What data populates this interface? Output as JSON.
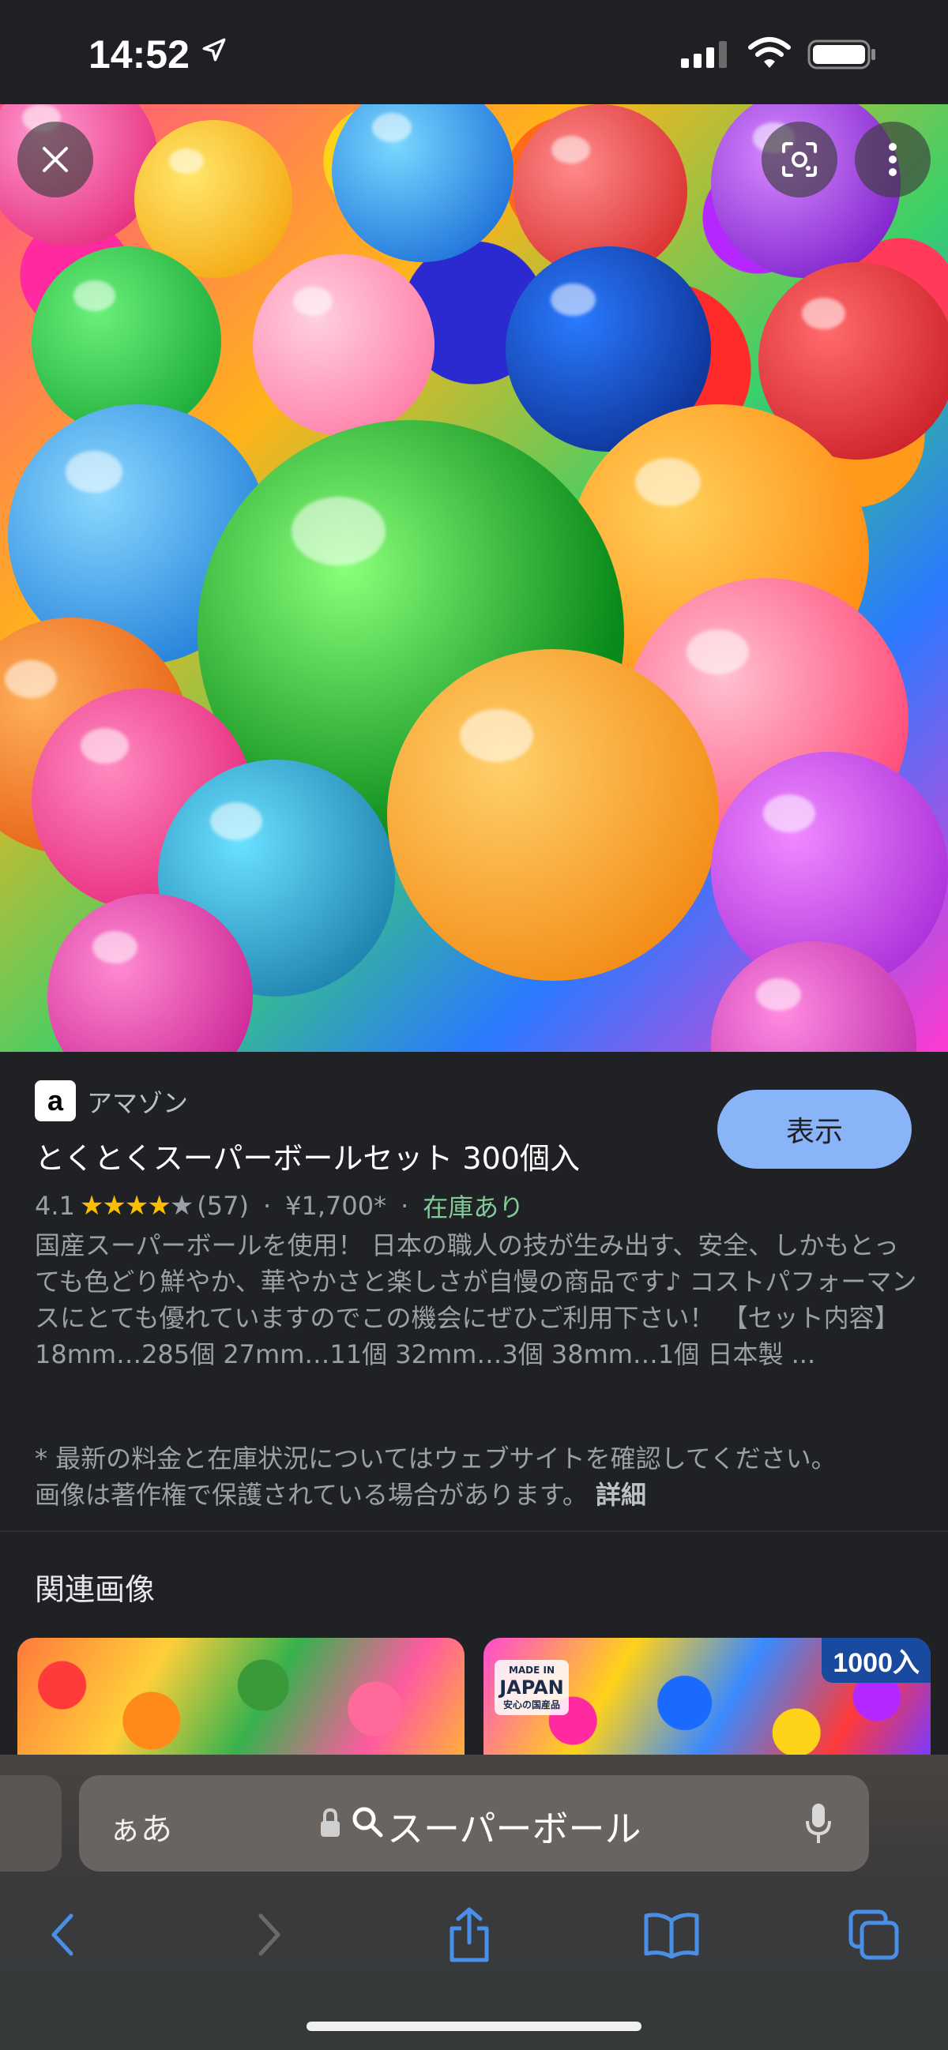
{
  "status_bar": {
    "time": "14:52",
    "icons": [
      "location-arrow-icon",
      "cellular-signal-icon",
      "wifi-icon",
      "battery-icon"
    ]
  },
  "image_viewer": {
    "buttons": [
      "close-icon",
      "lens-icon",
      "more-vert-icon"
    ]
  },
  "product": {
    "source_logo": "a",
    "source": "アマゾン",
    "title": "とくとくスーパーボールセット 300個入",
    "view_button": "表示",
    "rating": "4.1",
    "rating_value": 4.1,
    "review_count": "(57)",
    "separator": "·",
    "price": "¥1,700*",
    "stock": "在庫あり",
    "description": "国産スーパーボールを使用！ 日本の職人の技が生み出す、安全、しかもとっても色どり鮮やか、華やかさと楽しさが自慢の商品です♪ コストパフォーマンスにとても優れていますのでこの機会にぜひご利用下さい！ 【セット内容】 18mm…285個 27mm…11個 32mm…3個 38mm…1個 日本製 ...",
    "disclaimer": "* 最新の料金と在庫状況についてはウェブサイトを確認してください。 画像は著作権で保護されている場合があります。",
    "more_link": "詳細"
  },
  "related": {
    "heading": "関連画像",
    "thumb2_badge_line1": "MADE IN",
    "thumb2_badge_line2": "JAPAN",
    "thumb2_badge_line3": "安心の国産品",
    "thumb2_count": "1000入"
  },
  "browser": {
    "aa_button": "ぁあ",
    "query": "スーパーボール",
    "toolbar": [
      "back-icon",
      "forward-icon",
      "share-icon",
      "bookmarks-icon",
      "tabs-icon"
    ]
  },
  "colors": {
    "accent_button": "#8ab4f8",
    "stock_green": "#81c995",
    "star": "#fbbc04",
    "browser_blue": "#4a8fe7"
  }
}
